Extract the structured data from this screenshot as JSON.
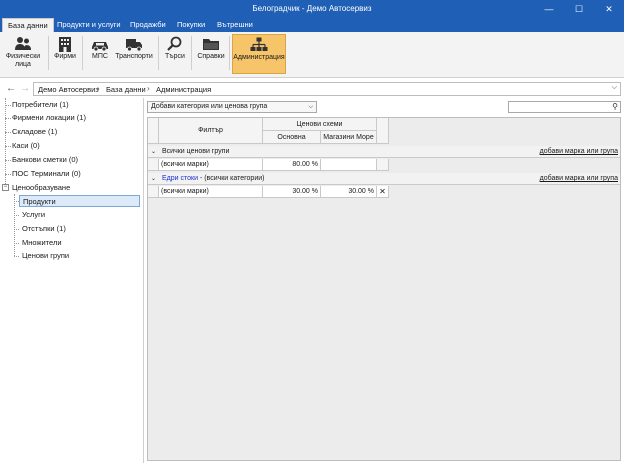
{
  "window": {
    "title": "Белоградчик - Демо Автосервиз",
    "minimize": "—",
    "maximize": "☐",
    "close": "✕"
  },
  "ribbon_tabs": [
    "База данни",
    "Продукти и услуги",
    "Продажби",
    "Покупки",
    "Вътрешни"
  ],
  "ribbon_buttons": {
    "physical": "Физически лица",
    "firms": "Фирми",
    "mps": "МПС",
    "transport": "Транспорти",
    "search": "Търси",
    "reports": "Справки",
    "admin": "Администрация"
  },
  "breadcrumb": {
    "items": [
      "Демо Автосервиз",
      "База данни",
      "Администрация"
    ]
  },
  "tree": {
    "items": [
      "Потребители (1)",
      "Фирмени локации (1)",
      "Складове (1)",
      "Каси (0)",
      "Банкови сметки (0)",
      "ПОС Терминали (0)",
      "Ценообразуване"
    ],
    "children": [
      "Продукти",
      "Услуги",
      "Отстъпки (1)",
      "Множители",
      "Ценови групи"
    ]
  },
  "filter": {
    "combo_value": "Добави категория или ценова група",
    "search_placeholder": ""
  },
  "grid": {
    "header_filter": "Филтър",
    "header_schemes": "Ценови схеми",
    "col_main": "Основна",
    "col_shop": "Магазини Море",
    "group1": {
      "title": "Всички ценови групи",
      "action": "добави марка или група",
      "row_label": "(всички марки)",
      "main": "80.00 %",
      "shop": ""
    },
    "group2": {
      "title_link": "Едри стоки",
      "title_rest": " - (всички категории)",
      "action": "добави марка или група",
      "row_label": "(всички марки)",
      "main": "30.00 %",
      "shop": "30.00 %",
      "remove": "✕"
    }
  }
}
